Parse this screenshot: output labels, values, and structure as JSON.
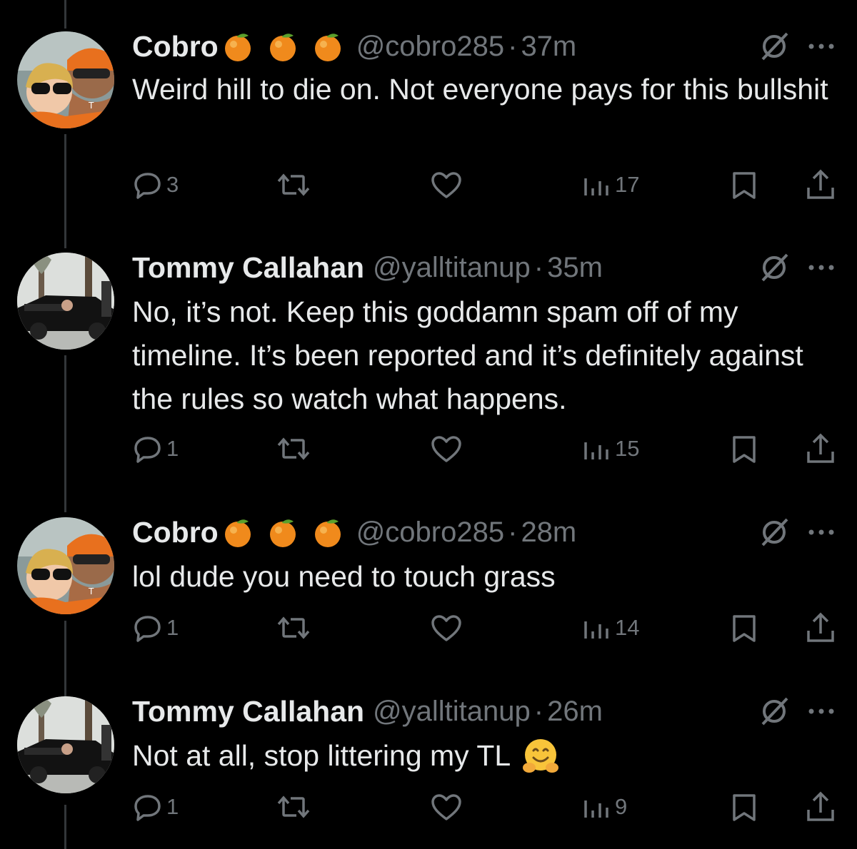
{
  "tweets": [
    {
      "name": "Cobro",
      "handle": "@cobro285",
      "separator": "·",
      "time": "37m",
      "emojis": [
        "orange-emoji",
        "orange-emoji",
        "orange-emoji"
      ],
      "text": "Weird hill to die on. Not everyone pays for this bullshit",
      "replies": "3",
      "views": "17"
    },
    {
      "name": "Tommy Callahan",
      "handle": "@yalltitanup",
      "separator": "·",
      "time": "35m",
      "emojis": [],
      "text": "No, it’s not. Keep this goddamn spam off of my timeline. It’s been reported and it’s definitely against the rules so watch what happens.",
      "replies": "1",
      "views": "15"
    },
    {
      "name": "Cobro",
      "handle": "@cobro285",
      "separator": "·",
      "time": "28m",
      "emojis": [
        "orange-emoji",
        "orange-emoji",
        "orange-emoji"
      ],
      "text": "lol dude you need to touch grass",
      "replies": "1",
      "views": "14"
    },
    {
      "name": "Tommy Callahan",
      "handle": "@yalltitanup",
      "separator": "·",
      "time": "26m",
      "emojis": [],
      "text": "Not at all, stop littering my TL",
      "text_emoji": "hugging-face-emoji",
      "replies": "1",
      "views": "9"
    }
  ],
  "colors": {
    "background": "#000000",
    "text": "#e7e9ea",
    "muted": "#71767b",
    "thread_line": "#333639"
  }
}
